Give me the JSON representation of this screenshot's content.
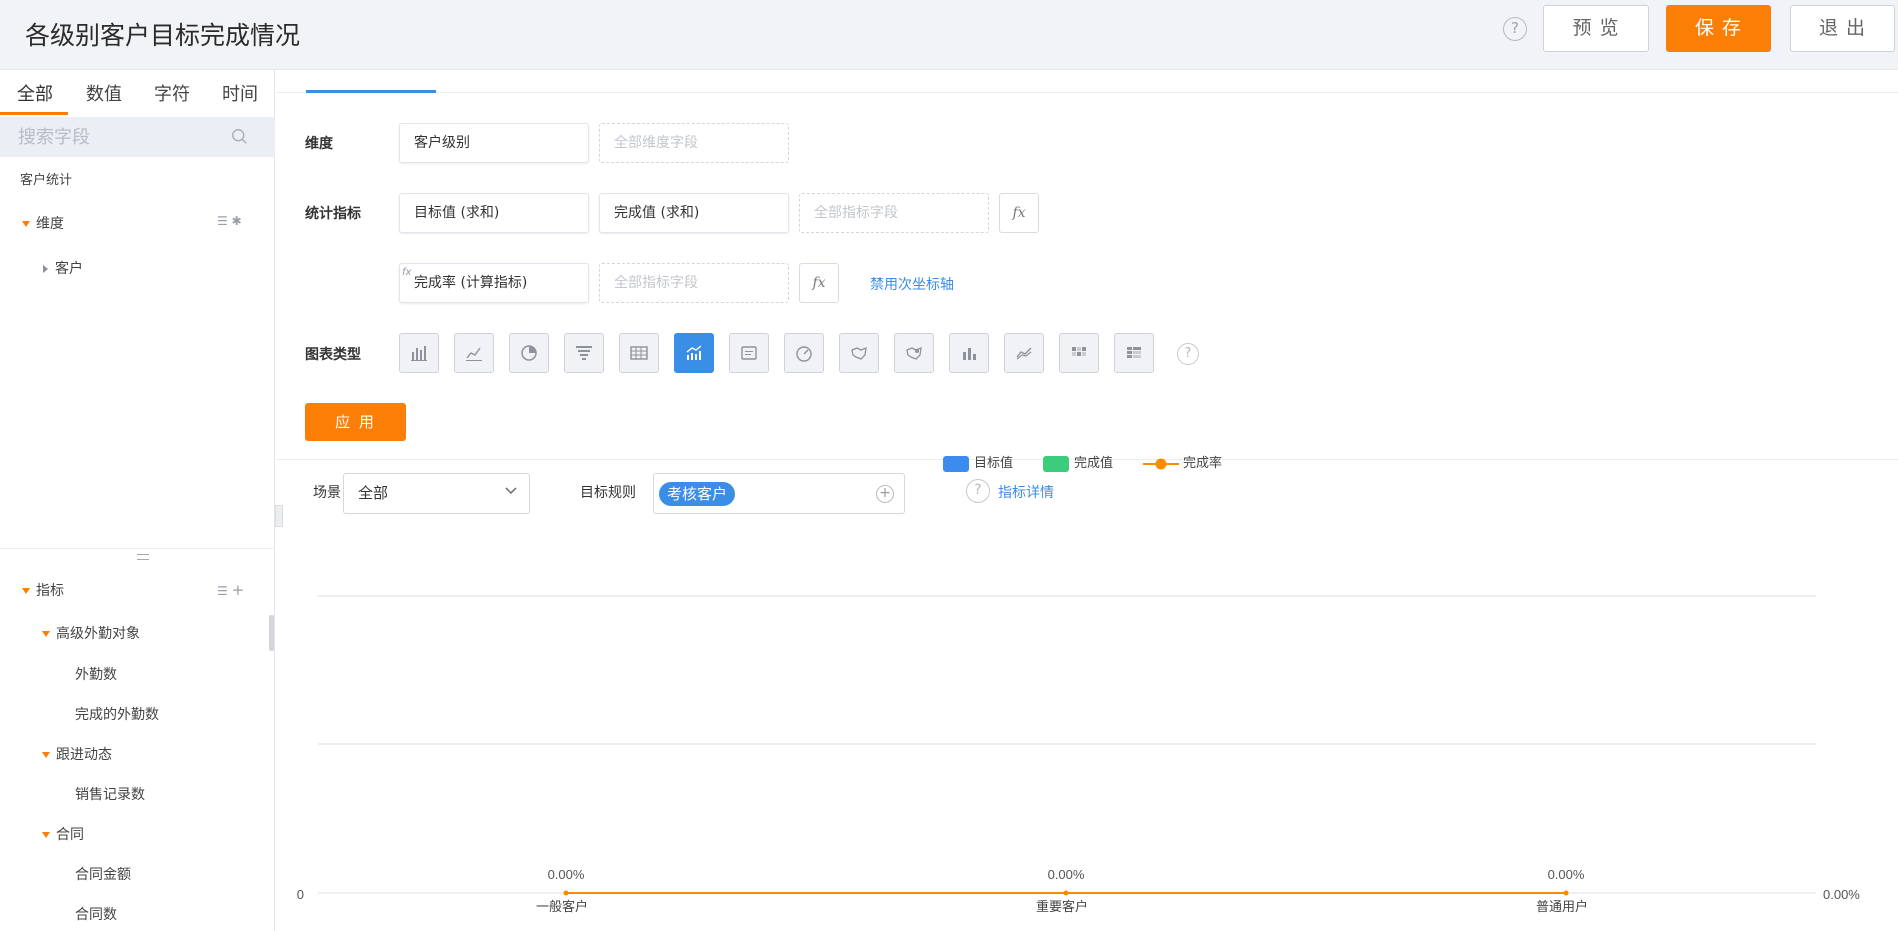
{
  "header": {
    "title": "各级别客户目标完成情况",
    "help_icon": "?",
    "preview_label": "预 览",
    "save_label": "保 存",
    "exit_label": "退 出"
  },
  "sidebar": {
    "tabs": [
      "全部",
      "数值",
      "字符",
      "时间"
    ],
    "active_tab": "全部",
    "search_placeholder": "搜索字段",
    "dataset": "客户统计",
    "dimension_group": "维度",
    "dimension_items": [
      "客户"
    ],
    "indicator_group": "指标",
    "indicator_tree": [
      {
        "group": "高级外勤对象",
        "items": [
          "外勤数",
          "完成的外勤数"
        ]
      },
      {
        "group": "跟进动态",
        "items": [
          "销售记录数"
        ]
      },
      {
        "group": "合同",
        "items": [
          "合同金额",
          "合同数"
        ]
      }
    ]
  },
  "config": {
    "dimension_label": "维度",
    "dimension_field": "客户级别",
    "dimension_placeholder": "全部维度字段",
    "metric_label": "统计指标",
    "metric_fields": [
      "目标值 (求和)",
      "完成值 (求和)"
    ],
    "metric_placeholder": "全部指标字段",
    "fx_label": "fx",
    "calc_field": "完成率 (计算指标)",
    "calc_tag": "fx",
    "calc_placeholder": "全部指标字段",
    "disable_axis_link": "禁用次坐标轴",
    "chart_type_label": "图表类型",
    "chart_types": [
      "bar-chart-icon",
      "line-chart-icon",
      "pie-chart-icon",
      "funnel-chart-icon",
      "table-chart-icon",
      "combo-chart-icon",
      "card-chart-icon",
      "gauge-chart-icon",
      "map-chart-icon",
      "bubble-map-icon",
      "stacked-bar-icon",
      "area-chart-icon",
      "heatmap-icon",
      "pivot-table-icon"
    ],
    "selected_chart_type": "combo-chart-icon",
    "apply_label": "应 用",
    "help_icon": "?"
  },
  "filters": {
    "scene_label": "场景",
    "scene_value": "全部",
    "rule_label": "目标规则",
    "rule_tag": "考核客户",
    "details_link": "指标详情",
    "help_icon": "?"
  },
  "colors": {
    "accent": "#fb7f07",
    "blue": "#3a8ee6",
    "target": "#3c8cf0",
    "complete": "#3ccd7c",
    "rate": "#fb8c00"
  },
  "chart_data": {
    "type": "bar",
    "categories": [
      "一般客户",
      "重要客户",
      "普通用户"
    ],
    "series": [
      {
        "name": "目标值",
        "type": "bar",
        "values": [
          0,
          0,
          0
        ]
      },
      {
        "name": "完成值",
        "type": "bar",
        "values": [
          0,
          0,
          0
        ]
      },
      {
        "name": "完成率",
        "type": "line",
        "values": [
          0,
          0,
          0
        ],
        "labels": [
          "0.00%",
          "0.00%",
          "0.00%"
        ]
      }
    ],
    "y_left_ticks": [
      "0"
    ],
    "y_right_ticks": [
      "0.00%"
    ],
    "legend_position": "top-center",
    "grid": true
  }
}
